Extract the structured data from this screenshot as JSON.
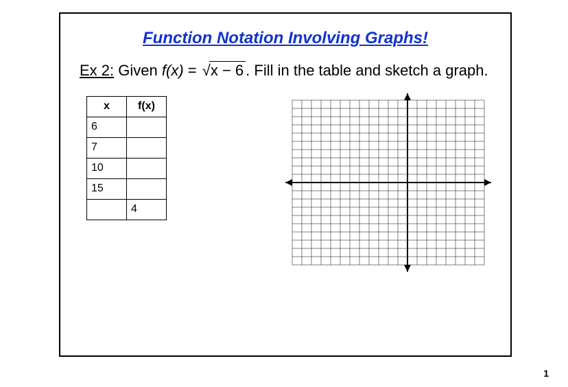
{
  "title": "Function Notation Involving Graphs!",
  "example": {
    "label": "Ex 2:",
    "lead": "Given",
    "func_lhs": "f(x)",
    "equals": "=",
    "radical": "√",
    "radicand": "x − 6",
    "period": ".",
    "instruction": "Fill in the table and sketch a graph."
  },
  "table": {
    "headers": {
      "x": "x",
      "fx": "f(x)"
    },
    "rows": [
      {
        "x": "6",
        "fx": ""
      },
      {
        "x": "7",
        "fx": ""
      },
      {
        "x": "10",
        "fx": ""
      },
      {
        "x": "15",
        "fx": ""
      },
      {
        "x": "",
        "fx": "4"
      }
    ]
  },
  "page_number": "1"
}
